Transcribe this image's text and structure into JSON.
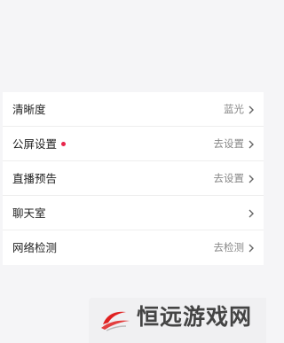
{
  "settings": {
    "rows": [
      {
        "label": "清晰度",
        "value": "蓝光",
        "has_dot": false
      },
      {
        "label": "公屏设置",
        "value": "去设置",
        "has_dot": true
      },
      {
        "label": "直播预告",
        "value": "去设置",
        "has_dot": false
      },
      {
        "label": "聊天室",
        "value": "",
        "has_dot": false
      },
      {
        "label": "网络检测",
        "value": "去检测",
        "has_dot": false
      }
    ]
  },
  "watermark": {
    "text": "恒远游戏网"
  },
  "colors": {
    "background": "#f5f5f7",
    "notification_dot": "#e8254b",
    "value_text": "#888888",
    "logo_red": "#e02020"
  }
}
